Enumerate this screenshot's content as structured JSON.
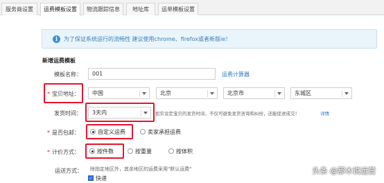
{
  "tabs": [
    "服务商设置",
    "运费模板设置",
    "物流跟踪信息",
    "地址库",
    "运单模板设置"
  ],
  "notice": {
    "icon": "info-icon",
    "text": "为了保证系统运行的流畅性 建议使用chrome、firefox或者新版ie！"
  },
  "section_title": "新增运费模板",
  "form": {
    "template_name": {
      "label": "模板名称：",
      "value": "001",
      "link": "运费计算器"
    },
    "location": {
      "label": "宝贝地址：",
      "country": "中国",
      "province": "北京",
      "city": "北京市",
      "district": "东城区"
    },
    "ship_time": {
      "label": "发货时间：",
      "value": "3天内",
      "hint": "如实设定宝贝的发货时间，不仅可避免发货咨询和纠纷，还能促进成交！",
      "link": "详情"
    },
    "free_shipping": {
      "label": "是否包邮：",
      "options": [
        "自定义运费",
        "卖家承担运费"
      ],
      "selected": 0
    },
    "pricing": {
      "label": "计价方式：",
      "options": [
        "按件数",
        "按重量",
        "按体积"
      ],
      "selected": 0
    },
    "shipping_method": {
      "label": "运送方式：",
      "hint": "除指定地区外，其余地区的运费采用\"默认运费\"",
      "checkbox_label": "快递",
      "checked": true
    }
  },
  "watermark": "头条 @那木说运营",
  "colors": {
    "highlight": "#e8132b",
    "link": "#2b77c6",
    "notice_bg": "#eaf4fb"
  }
}
